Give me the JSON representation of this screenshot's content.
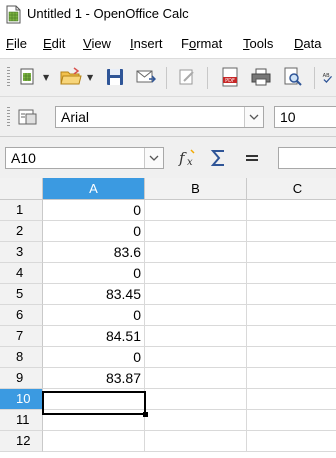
{
  "window": {
    "title": "Untitled 1 - OpenOffice Calc"
  },
  "menu": [
    {
      "label": "File",
      "accel": "F",
      "rest": "ile"
    },
    {
      "label": "Edit",
      "accel": "E",
      "rest": "dit"
    },
    {
      "label": "View",
      "accel": "V",
      "rest": "iew"
    },
    {
      "label": "Insert",
      "accel": "I",
      "rest": "nsert"
    },
    {
      "label": "Format",
      "accel": "o",
      "pre": "F",
      "rest": "rmat"
    },
    {
      "label": "Tools",
      "accel": "T",
      "rest": "ools"
    },
    {
      "label": "Data",
      "accel": "D",
      "rest": "ata"
    }
  ],
  "formatting": {
    "font_name": "Arial",
    "font_size": "10"
  },
  "formula_bar": {
    "name_box": "A10",
    "input": ""
  },
  "columns": [
    "A",
    "B",
    "C"
  ],
  "rows": [
    "1",
    "2",
    "3",
    "4",
    "5",
    "6",
    "7",
    "8",
    "9",
    "10",
    "11",
    "12"
  ],
  "cells_A": [
    "0",
    "0",
    "83.6",
    "0",
    "83.45",
    "0",
    "84.51",
    "0",
    "83.87",
    "",
    "",
    ""
  ],
  "selected": {
    "column": "A",
    "row": "10"
  },
  "colors": {
    "selection": "#3b9ae1",
    "header": "#f2f2f2"
  }
}
